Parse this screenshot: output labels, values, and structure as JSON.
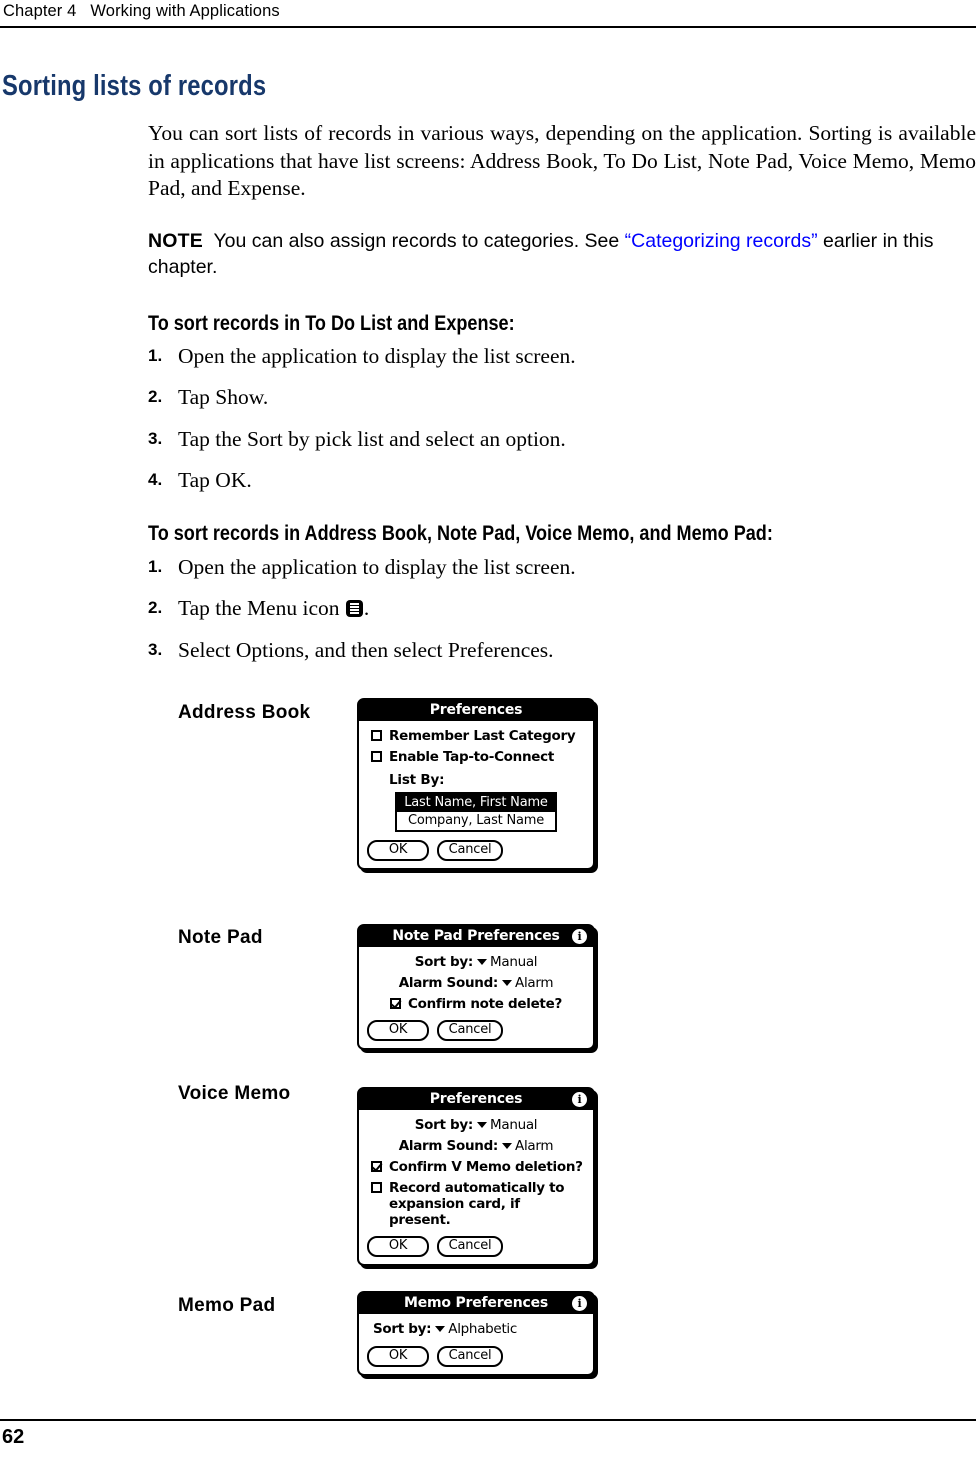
{
  "header": {
    "chapter_line": "Chapter 4   Working with Applications"
  },
  "section": {
    "heading": "Sorting lists of records"
  },
  "intro": {
    "paragraph": "You can sort lists of records in various ways, depending on the application. Sorting is available in applications that have list screens: Address Book, To Do List, Note Pad, Voice Memo, Memo Pad, and Expense."
  },
  "note": {
    "label": "NOTE",
    "text_before_link": "You can also assign records to categories. See ",
    "link_text": "“Categorizing records”",
    "text_after_link": " earlier in this chapter.",
    "link_color": "#0000ff"
  },
  "procedures": [
    {
      "heading": "To sort records in To Do List and Expense:",
      "steps": [
        {
          "num": "1.",
          "text": "Open the application to display the list screen."
        },
        {
          "num": "2.",
          "text": "Tap Show."
        },
        {
          "num": "3.",
          "text": "Tap the Sort by pick list and select an option."
        },
        {
          "num": "4.",
          "text": "Tap OK."
        }
      ]
    },
    {
      "heading": "To sort records in Address Book, Note Pad, Voice Memo, and Memo Pad:",
      "steps": [
        {
          "num": "1.",
          "text": "Open the application to display the list screen."
        },
        {
          "num": "2.",
          "text_before_icon": "Tap the Menu icon ",
          "icon": "menu-icon",
          "text_after_icon": "."
        },
        {
          "num": "3.",
          "text": "Select Options, and then select Preferences."
        }
      ]
    }
  ],
  "dialogs": [
    {
      "app_label": "Address Book",
      "title": "Preferences",
      "has_info_icon": false,
      "checkboxes": [
        {
          "label": "Remember Last Category",
          "checked": false
        },
        {
          "label": "Enable Tap-to-Connect",
          "checked": false
        }
      ],
      "sublabel": "List By:",
      "listbox": [
        {
          "label": "Last Name, First Name",
          "selected": true
        },
        {
          "label": "Company, Last Name",
          "selected": false
        }
      ],
      "buttons": {
        "ok": "OK",
        "cancel": "Cancel"
      }
    },
    {
      "app_label": "Note Pad",
      "title": "Note Pad Preferences",
      "has_info_icon": true,
      "info_icon": "info-icon",
      "sort_rows": [
        {
          "key": "Sort by:",
          "value": "Manual"
        },
        {
          "key": "Alarm Sound:",
          "value": "Alarm"
        }
      ],
      "checkboxes": [
        {
          "label": "Confirm note delete?",
          "checked": true
        }
      ],
      "buttons": {
        "ok": "OK",
        "cancel": "Cancel"
      }
    },
    {
      "app_label": "Voice Memo",
      "title": "Preferences",
      "has_info_icon": true,
      "info_icon": "info-icon",
      "sort_rows": [
        {
          "key": "Sort by:",
          "value": "Manual"
        },
        {
          "key": "Alarm Sound:",
          "value": "Alarm"
        }
      ],
      "checkboxes": [
        {
          "label": "Confirm V Memo deletion?",
          "checked": true
        },
        {
          "label": "Record automatically to expansion card, if present.",
          "checked": false
        }
      ],
      "buttons": {
        "ok": "OK",
        "cancel": "Cancel"
      }
    },
    {
      "app_label": "Memo Pad",
      "title": "Memo Preferences",
      "has_info_icon": true,
      "info_icon": "info-icon",
      "sort_rows": [
        {
          "key": "Sort by:",
          "value": "Alphabetic"
        }
      ],
      "buttons": {
        "ok": "OK",
        "cancel": "Cancel"
      }
    }
  ],
  "footer": {
    "page_number": "62"
  }
}
